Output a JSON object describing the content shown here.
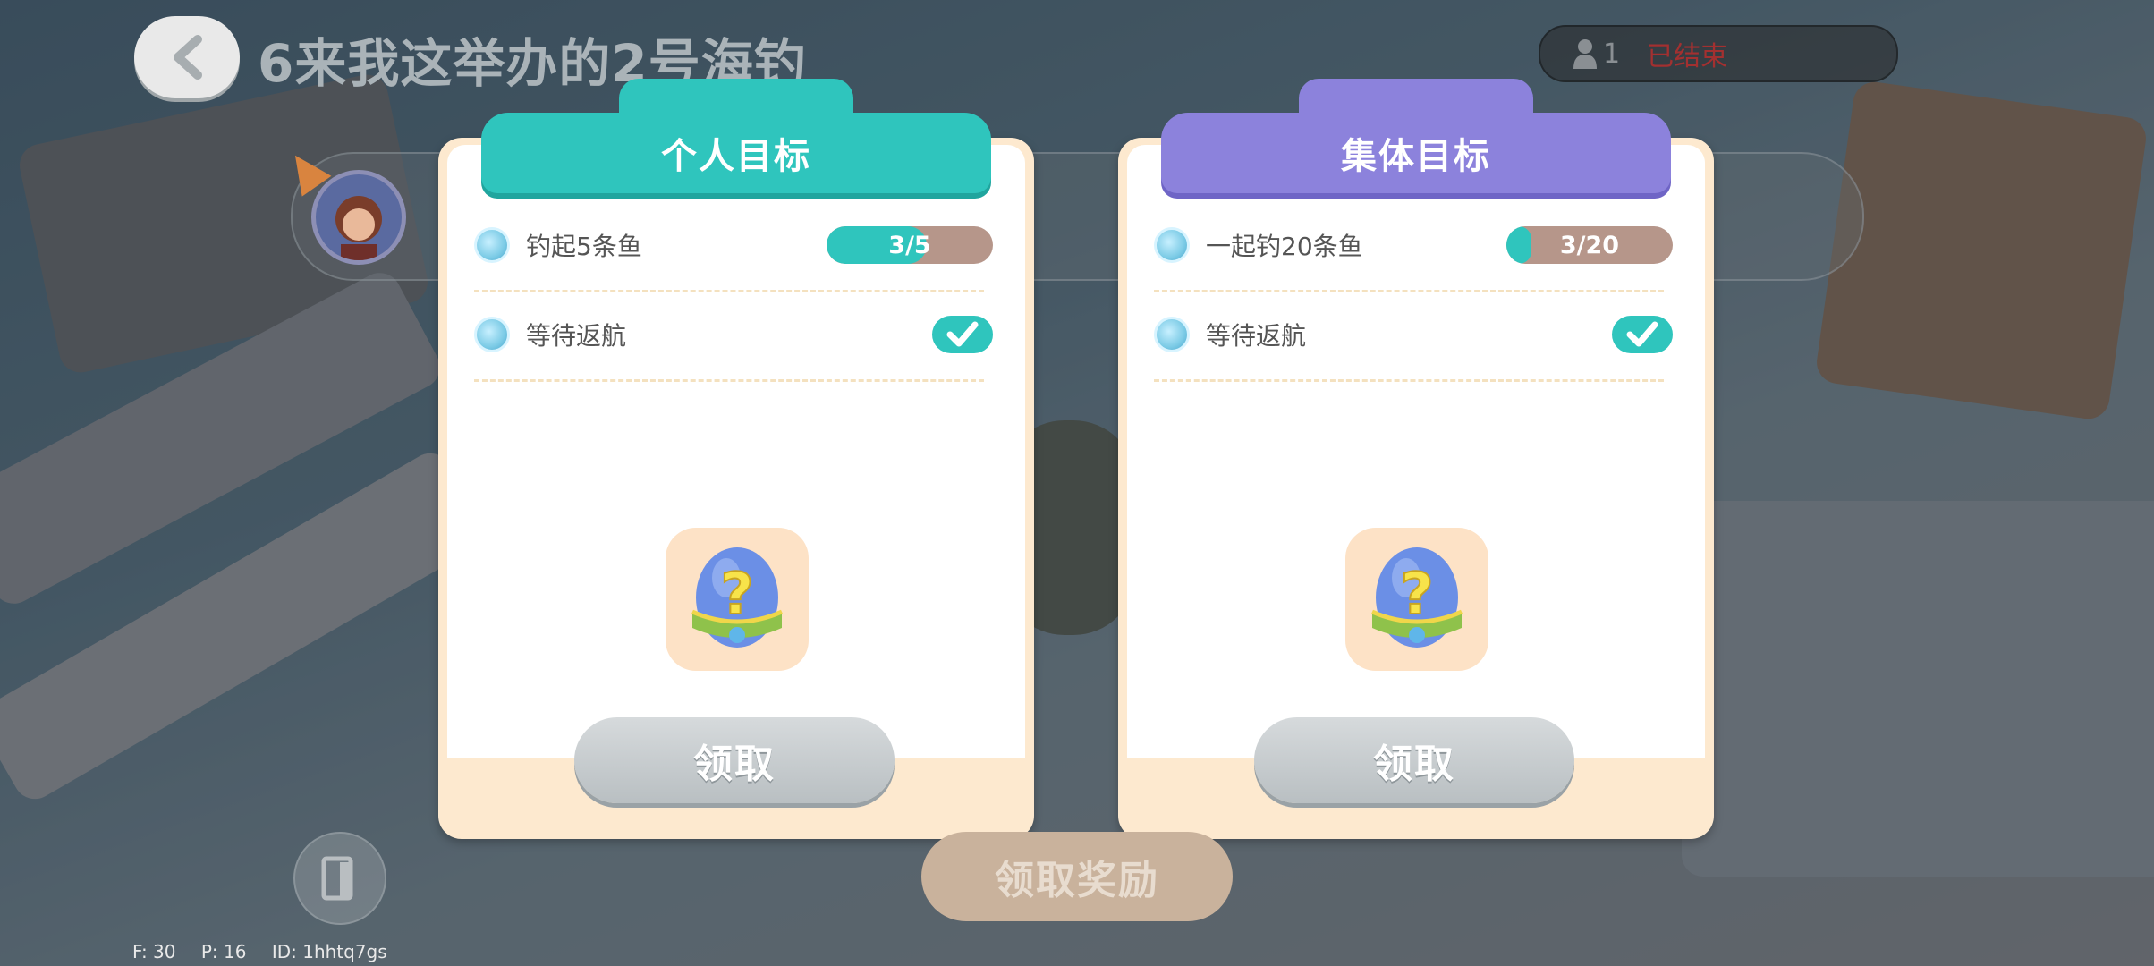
{
  "header": {
    "title": "6来我这举办的2号海钓",
    "player_count": "1",
    "status": "已结束"
  },
  "cards": [
    {
      "title": "个人目标",
      "theme": "teal",
      "goals": [
        {
          "label": "钓起5条鱼",
          "type": "progress",
          "current": 3,
          "target": 5,
          "text": "3/5"
        },
        {
          "label": "等待返航",
          "type": "check",
          "done": true
        }
      ],
      "reward_icon": "mystery-egg-icon",
      "claim_label": "领取"
    },
    {
      "title": "集体目标",
      "theme": "purple",
      "goals": [
        {
          "label": "一起钓20条鱼",
          "type": "progress",
          "current": 3,
          "target": 20,
          "text": "3/20"
        },
        {
          "label": "等待返航",
          "type": "check",
          "done": true
        }
      ],
      "reward_icon": "mystery-egg-icon",
      "claim_label": "领取"
    }
  ],
  "footer": {
    "claim_all_label": "领取奖励",
    "debug_f": "F: 30",
    "debug_p": "P: 16",
    "debug_id": "ID: 1hhtq7gs"
  },
  "colors": {
    "teal": "#2fc5bd",
    "purple": "#8c82dc",
    "progress_bg": "#b6968a",
    "status_red": "#a33030",
    "card_bg": "#fde9cf"
  }
}
